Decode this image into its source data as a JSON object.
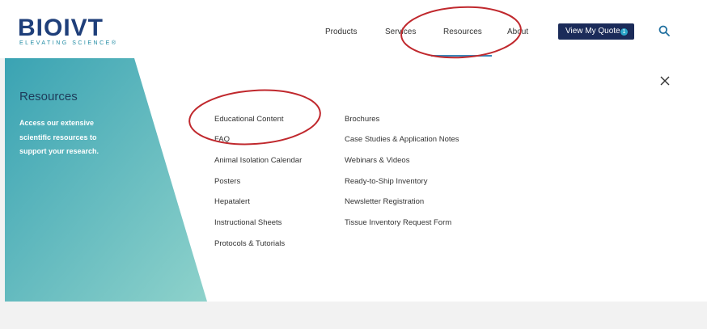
{
  "header": {
    "logo": {
      "wordmark": "BIOIVT",
      "tagline": "ELEVATING SCIENCE®"
    },
    "nav": [
      "Products",
      "Services",
      "Resources",
      "About"
    ],
    "active_nav": "Resources",
    "quote_button": {
      "label": "View My Quote",
      "count": "1"
    },
    "search_icon": "search-icon"
  },
  "menu": {
    "title": "Resources",
    "description": "Access our extensive scientific resources to support your research.",
    "close_icon": "close-icon",
    "column1": [
      "Educational Content",
      "FAQ",
      "Animal Isolation Calendar",
      "Posters",
      "Hepatalert",
      "Instructional Sheets",
      "Protocols & Tutorials"
    ],
    "column2": [
      "Brochures",
      "Case Studies & Application Notes",
      "Webinars & Videos",
      "Ready-to-Ship Inventory",
      "Newsletter Registration",
      "Tissue Inventory Request Form"
    ]
  },
  "colors": {
    "brand_navy": "#1b2b59",
    "teal_light": "#8fd3cf",
    "teal_dark": "#3a9fb0",
    "annotation_red": "#c0282d"
  }
}
